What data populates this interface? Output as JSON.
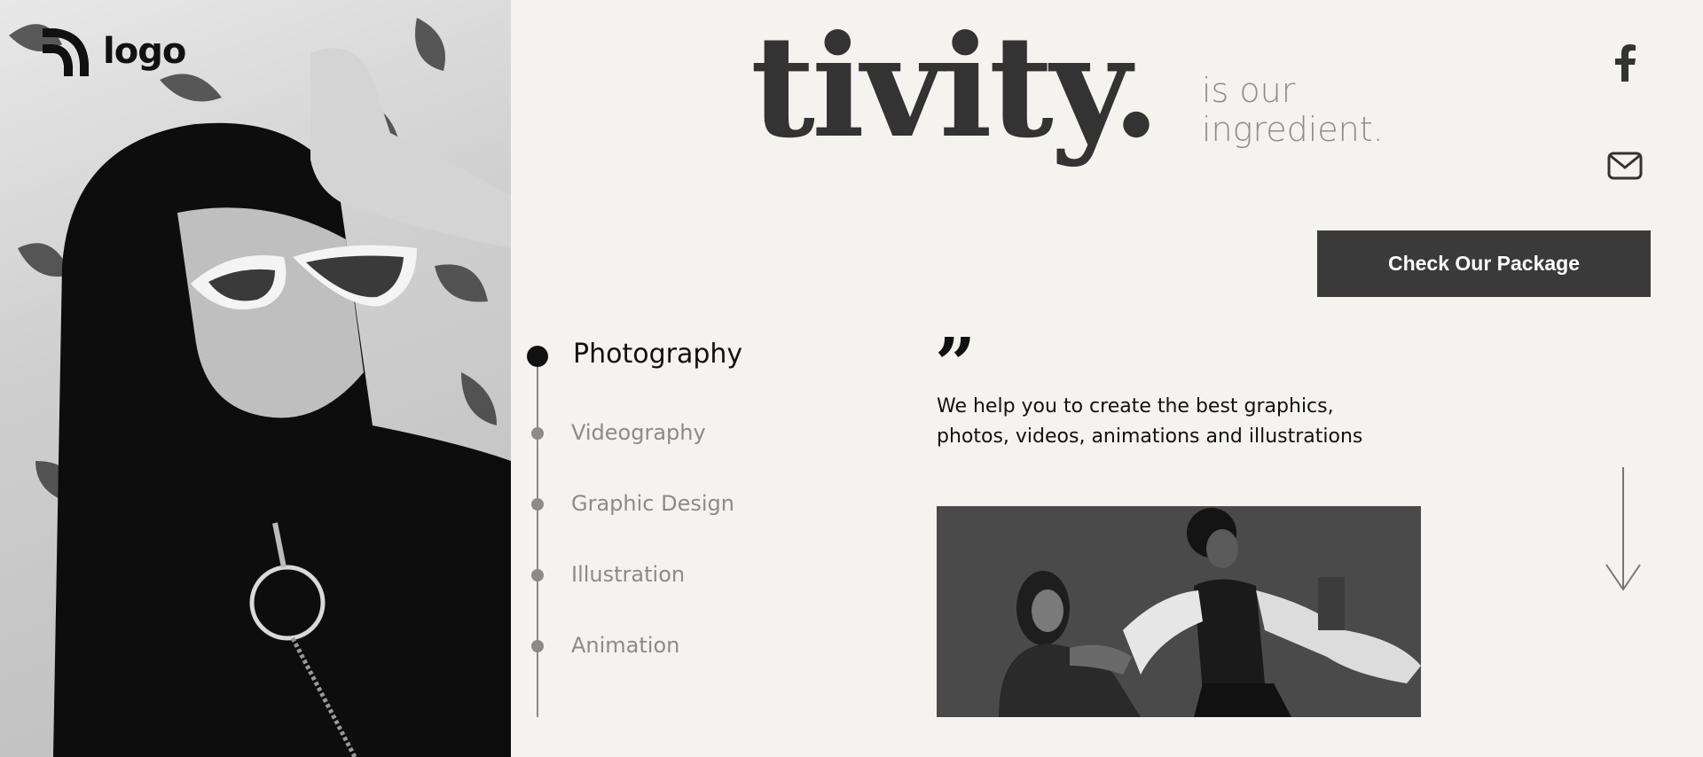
{
  "brand": {
    "logo_text": "logo"
  },
  "headline": {
    "word": "tivity.",
    "tagline_line1": "is our",
    "tagline_line2": "ingredient."
  },
  "social": {
    "facebook_icon": "facebook-icon",
    "mail_icon": "mail-icon"
  },
  "cta": {
    "label": "Check Our Package"
  },
  "services": {
    "items": [
      {
        "label": "Photography",
        "active": true
      },
      {
        "label": "Videography",
        "active": false
      },
      {
        "label": "Graphic Design",
        "active": false
      },
      {
        "label": "Illustration",
        "active": false
      },
      {
        "label": "Animation",
        "active": false
      }
    ]
  },
  "quote": {
    "mark": "”",
    "line1": "We help you to create the best graphics,",
    "line2": "photos, videos, animations and illustrations"
  },
  "colors": {
    "background": "#f5f3f0",
    "dark": "#3a3a3a",
    "muted": "#8b8b8b"
  }
}
